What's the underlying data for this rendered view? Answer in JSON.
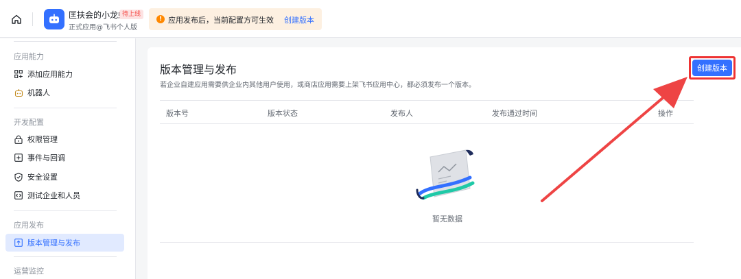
{
  "header": {
    "app_name": "匡扶会的小龙虾",
    "app_status": "待上线",
    "app_subtitle": "正式应用@飞书个人版",
    "notice_text": "应用发布后，当前配置方可生效",
    "notice_link": "创建版本",
    "notice_icon": "warning-icon"
  },
  "sidebar": {
    "groups": [
      {
        "title": "应用能力",
        "items": [
          {
            "label": "添加应用能力",
            "icon": "grid-icon"
          },
          {
            "label": "机器人",
            "icon": "robot-icon"
          }
        ]
      },
      {
        "title": "开发配置",
        "items": [
          {
            "label": "权限管理",
            "icon": "lock-icon"
          },
          {
            "label": "事件与回调",
            "icon": "event-icon"
          },
          {
            "label": "安全设置",
            "icon": "shield-icon"
          },
          {
            "label": "测试企业和人员",
            "icon": "code-icon"
          }
        ]
      },
      {
        "title": "应用发布",
        "items": [
          {
            "label": "版本管理与发布",
            "icon": "upload-icon",
            "active": true
          }
        ]
      },
      {
        "title": "运营监控",
        "items": []
      }
    ]
  },
  "main": {
    "title": "版本管理与发布",
    "description": "若企业自建应用需要供企业内其他用户使用，或商店应用需要上架飞书应用中心，都必须发布一个版本。",
    "create_button": "创建版本",
    "table": {
      "columns": [
        "版本号",
        "版本状态",
        "发布人",
        "发布通过时间",
        "操作"
      ],
      "rows": []
    },
    "empty_text": "暂无数据"
  },
  "colors": {
    "accent": "#3370ff",
    "annotation": "#ee3333",
    "warning": "#ff8800"
  }
}
